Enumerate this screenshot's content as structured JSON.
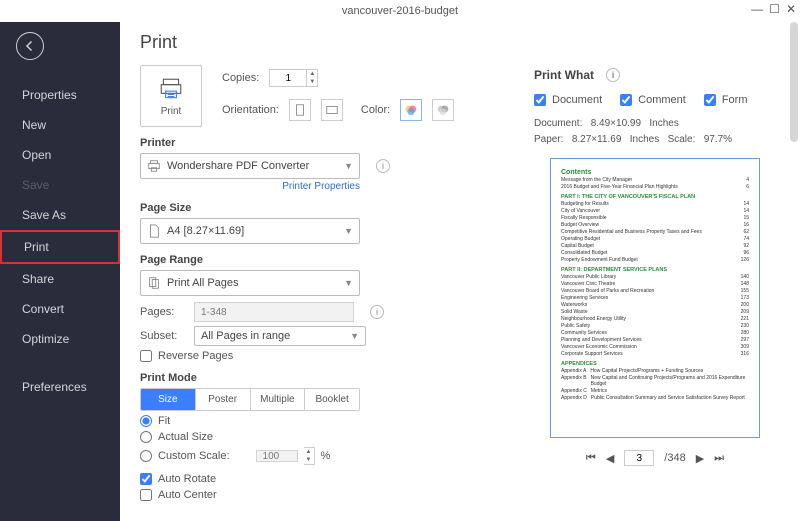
{
  "window": {
    "title": "vancouver-2016-budget"
  },
  "sidebar": {
    "items": [
      {
        "label": "Properties"
      },
      {
        "label": "New"
      },
      {
        "label": "Open"
      },
      {
        "label": "Save",
        "disabled": true
      },
      {
        "label": "Save As"
      },
      {
        "label": "Print",
        "selected": true
      },
      {
        "label": "Share"
      },
      {
        "label": "Convert"
      },
      {
        "label": "Optimize"
      },
      {
        "label": "Preferences",
        "gap": true
      }
    ]
  },
  "page_title": "Print",
  "print_label": "Print",
  "copies": {
    "label": "Copies:",
    "value": "1"
  },
  "orientation": {
    "label": "Orientation:"
  },
  "color": {
    "label": "Color:"
  },
  "printer": {
    "header": "Printer",
    "value": "Wondershare PDF Converter",
    "properties_link": "Printer Properties"
  },
  "page_size": {
    "header": "Page Size",
    "value": "A4 [8.27×11.69]"
  },
  "page_range": {
    "header": "Page Range",
    "value": "Print All Pages",
    "pages_label": "Pages:",
    "pages_value": "1-348",
    "subset_label": "Subset:",
    "subset_value": "All Pages in range",
    "reverse": "Reverse Pages"
  },
  "print_mode": {
    "header": "Print Mode",
    "tabs": [
      "Size",
      "Poster",
      "Multiple",
      "Booklet"
    ],
    "selected": 0,
    "fit": "Fit",
    "actual": "Actual Size",
    "custom": "Custom Scale:",
    "custom_value": "100",
    "percent": "%",
    "auto_rotate": "Auto Rotate",
    "auto_center": "Auto Center"
  },
  "print_what": {
    "header": "Print What",
    "options": [
      "Document",
      "Comment",
      "Form"
    ],
    "doc_label": "Document:",
    "doc_dims": "8.49×10.99",
    "paper_label": "Paper:",
    "paper_dims": "8.27×11.69",
    "unit": "Inches",
    "scale_label": "Scale:",
    "scale_value": "97.7%"
  },
  "preview_nav": {
    "page": "3",
    "total": "/348"
  },
  "preview_doc": {
    "title": "Contents",
    "lines": [
      {
        "t": "Message from the City Manager",
        "p": "4"
      },
      {
        "t": "2016 Budget and Five-Year Financial Plan Highlights",
        "p": "6"
      }
    ],
    "s1": "PART I: THE CITY OF VANCOUVER'S FISCAL PLAN",
    "s1lines": [
      {
        "t": "Budgeting for Results",
        "p": "14"
      },
      {
        "t": "City of Vancouver",
        "p": "14"
      },
      {
        "t": "Fiscally Responsible",
        "p": "15"
      },
      {
        "t": "Budget Overview",
        "p": "16"
      },
      {
        "t": "Competitive Residential and Business Property Taxes and Fees",
        "p": "62"
      },
      {
        "t": "Operating Budget",
        "p": "74"
      },
      {
        "t": "Capital Budget",
        "p": "92"
      },
      {
        "t": "Consolidated Budget",
        "p": "96"
      },
      {
        "t": "Property Endowment Fund Budget",
        "p": "126"
      }
    ],
    "s2": "PART II: DEPARTMENT SERVICE PLANS",
    "s2lines": [
      {
        "t": "Vancouver Public Library",
        "p": "140"
      },
      {
        "t": "Vancouver Civic Theatre",
        "p": "148"
      },
      {
        "t": "Vancouver Board of Parks and Recreation",
        "p": "155"
      },
      {
        "t": "Engineering Services",
        "p": "173"
      },
      {
        "t": "Waterworks",
        "p": "200"
      },
      {
        "t": "Solid Waste",
        "p": "209"
      },
      {
        "t": "Neighbourhood Energy Utility",
        "p": "221"
      },
      {
        "t": "Public Safety",
        "p": "230"
      },
      {
        "t": "Community Services",
        "p": "280"
      },
      {
        "t": "Planning and Development Services",
        "p": "297"
      },
      {
        "t": "Vancouver Economic Commission",
        "p": "309"
      },
      {
        "t": "Corporate Support Services",
        "p": "316"
      }
    ],
    "s3": "APPENDICES",
    "s3lines": [
      {
        "t": "Appendix A",
        "d": "How Capital Projects/Programs + Funding Sources"
      },
      {
        "t": "Appendix B",
        "d": "New Capital and Continuing Projects/Programs and 2016 Expenditure Budget"
      },
      {
        "t": "Appendix C",
        "d": "Metrics"
      },
      {
        "t": "Appendix D",
        "d": "Public Consultation Summary and Service Satisfaction Survey Report"
      }
    ]
  }
}
